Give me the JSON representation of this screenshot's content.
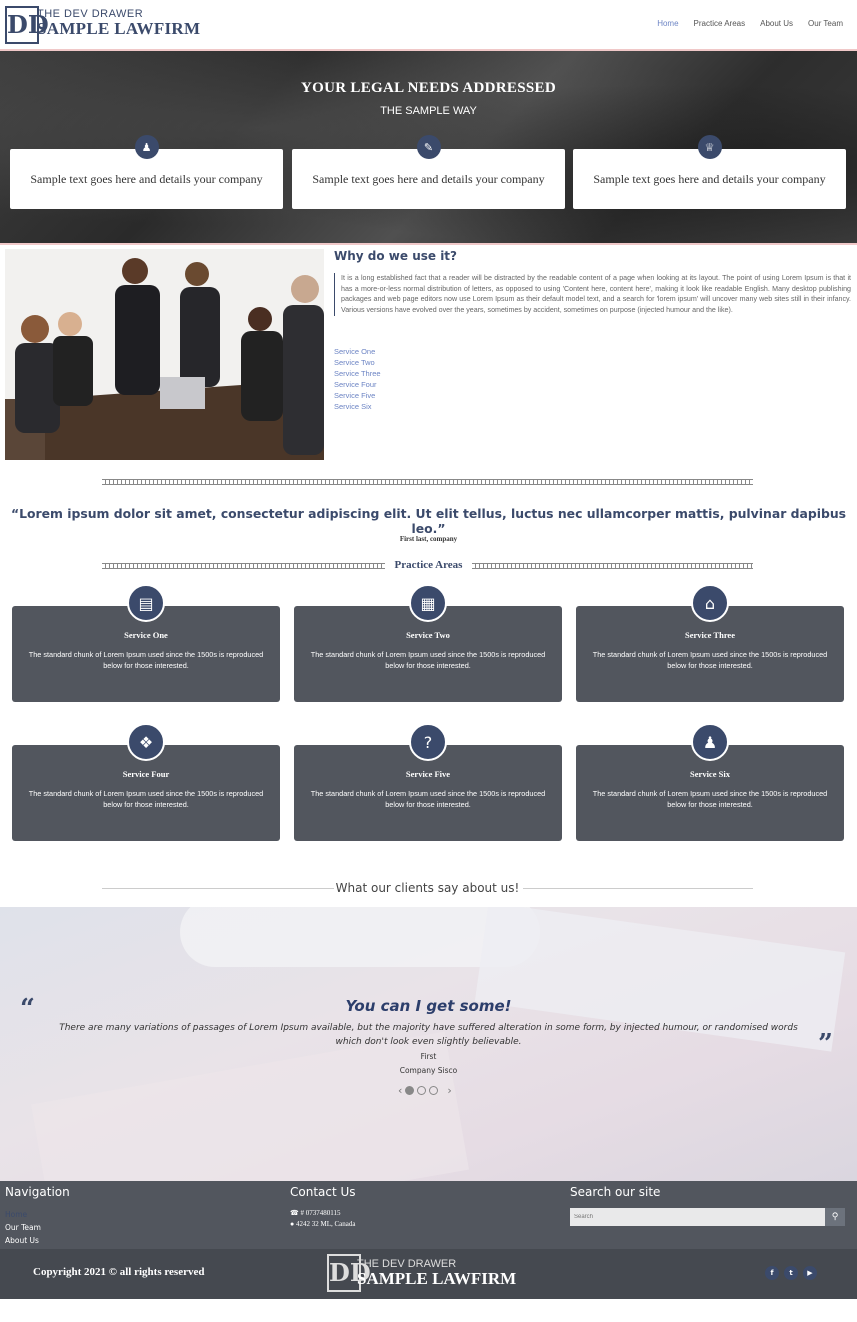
{
  "header": {
    "logo_line1": "THE DEV DRAWER",
    "logo_line2": "SAMPLE LAWFIRM",
    "logo_mark": "DD",
    "nav": [
      "Home",
      "Practice Areas",
      "About Us",
      "Our Team"
    ],
    "active_nav": "Home",
    "active_color": "#6c84c4"
  },
  "hero": {
    "title": "YOUR LEGAL NEEDS ADDRESSED",
    "subtitle": "THE SAMPLE WAY",
    "cards": [
      {
        "icon": "lawyer-icon",
        "text": "Sample text goes here and details your company"
      },
      {
        "icon": "pen-icon",
        "text": "Sample text goes here and details your company"
      },
      {
        "icon": "trophy-icon",
        "text": "Sample text goes here and details your company"
      }
    ]
  },
  "why": {
    "title": "Why do we use it?",
    "body": "It is a long established fact that a reader will be distracted by the readable content of a page when looking at its layout. The point of using Lorem Ipsum is that it has a more-or-less normal distribution of letters, as opposed to using 'Content here, content here', making it look like readable English. Many desktop publishing packages and web page editors now use Lorem Ipsum as their default model text, and a search for 'lorem ipsum' will uncover many web sites still in their infancy. Various versions have evolved over the years, sometimes by accident, sometimes on purpose (injected humour and the like).",
    "services": [
      "Service One",
      "Service Two",
      "Service Three",
      "Service Four",
      "Service Five",
      "Service Six"
    ]
  },
  "quote": {
    "text": "“Lorem ipsum dolor sit amet, consectetur adipiscing elit. Ut elit tellus, luctus nec ullamcorper mattis, pulvinar dapibus leo.”",
    "author": "First last, company"
  },
  "practice": {
    "title": "Practice Areas",
    "cards": [
      {
        "icon": "book-icon",
        "title": "Service One",
        "desc": "The standard chunk of Lorem Ipsum used since the 1500s is reproduced below for those interested."
      },
      {
        "icon": "building-icon",
        "title": "Service Two",
        "desc": "The standard chunk of Lorem Ipsum used since the 1500s is reproduced below for those interested."
      },
      {
        "icon": "home-icon",
        "title": "Service Three",
        "desc": "The standard chunk of Lorem Ipsum used since the 1500s is reproduced below for those interested."
      },
      {
        "icon": "puzzle-icon",
        "title": "Service Four",
        "desc": "The standard chunk of Lorem Ipsum used since the 1500s is reproduced below for those interested."
      },
      {
        "icon": "question-icon",
        "title": "Service Five",
        "desc": "The standard chunk of Lorem Ipsum used since the 1500s is reproduced below for those interested."
      },
      {
        "icon": "user-tie-icon",
        "title": "Service Six",
        "desc": "The standard chunk of Lorem Ipsum used since the 1500s is reproduced below for those interested."
      }
    ]
  },
  "clients": {
    "heading": "What our clients say about us!",
    "testimonial_title": "You can I get some!",
    "testimonial_body": "There are many variations of passages of Lorem Ipsum available, but the majority have suffered alteration in some form, by injected humour, or randomised words which don't look even slightly believable.",
    "name": "First",
    "company": "Company Sisco",
    "prev": "‹",
    "next": "›",
    "slides": 3,
    "active_slide": 1
  },
  "footer": {
    "nav_heading": "Navigation",
    "nav_links": [
      "Home",
      "Our Team",
      "About Us"
    ],
    "contact_heading": "Contact Us",
    "phone": "# 0737480115",
    "address": "4242 32 ML, Canada",
    "search_heading": "Search our site",
    "search_placeholder": "Search",
    "copyright": "Copyright 2021 © all rights reserved",
    "logo_line1": "THE DEV DRAWER",
    "logo_line2": "SAMPLE LAWFIRM",
    "social": [
      "facebook-icon",
      "twitter-icon",
      "youtube-icon"
    ]
  },
  "colors": {
    "brand": "#3b4a6b",
    "card_bg": "#52565e",
    "link": "#6c84c4"
  }
}
